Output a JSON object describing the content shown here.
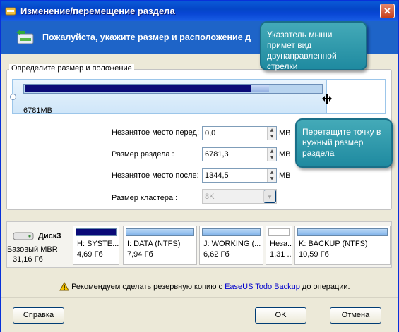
{
  "window": {
    "title": "Изменение/перемещение раздела",
    "close_glyph": "✕"
  },
  "header": {
    "instruction": "Пожалуйста, укажите размер и расположение д"
  },
  "size_group": {
    "label": "Определите размер и положение",
    "partition_size_text": "6781MB",
    "bar_fill_fraction": 0.834
  },
  "form": {
    "free_before_label": "Незанятое место перед:",
    "free_before_value": "0,0",
    "partition_size_label": "Размер раздела :",
    "partition_size_value": "6781,3",
    "free_after_label": "Незанятое место после:",
    "free_after_value": "1344,5",
    "unit": "MB",
    "cluster_label": "Размер кластера :",
    "cluster_value": "8K"
  },
  "callouts": {
    "cursor_note": "Указатель мыши примет вид двунаправленной стрелки",
    "drag_note": "Перетащите точку в нужный размер раздела"
  },
  "disk": {
    "name": "Диск3",
    "type": "Базовый MBR",
    "size": "31,16 Гб",
    "partitions": [
      {
        "name": "H: SYSTE...",
        "size": "4,69 Гб",
        "selected": true
      },
      {
        "name": "I: DATA (NTFS)",
        "size": "7,94 Гб",
        "selected": false
      },
      {
        "name": "J: WORKING (...",
        "size": "6,62 Гб",
        "selected": false
      },
      {
        "name": "Неза...",
        "size": "1,31 ...",
        "selected": false
      },
      {
        "name": "K: BACKUP (NTFS)",
        "size": "10,59 Гб",
        "selected": false
      }
    ]
  },
  "warning": {
    "prefix": "Рекомендуем сделать резервную копию с ",
    "link": "EaseUS Todo Backup",
    "suffix": " до операции."
  },
  "buttons": {
    "help": "Справка",
    "ok": "OK",
    "cancel": "Отмена"
  },
  "colors": {
    "selected_partition": "#0a0a78",
    "partition_bar": "#7fb2ea",
    "header_bg": "#1e64c8",
    "callout": "#2a96aa"
  }
}
